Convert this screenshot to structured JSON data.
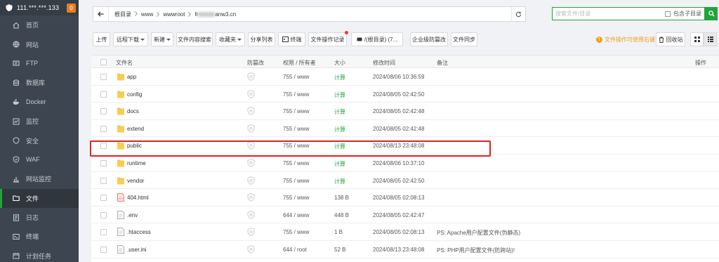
{
  "server": {
    "ip": "111.***.***.133",
    "badge": "0"
  },
  "sidebar": {
    "items": [
      {
        "label": "首页",
        "icon": "home-icon"
      },
      {
        "label": "网站",
        "icon": "globe-icon"
      },
      {
        "label": "FTP",
        "icon": "ftp-icon"
      },
      {
        "label": "数据库",
        "icon": "database-icon"
      },
      {
        "label": "Docker",
        "icon": "docker-icon"
      },
      {
        "label": "监控",
        "icon": "monitor-icon"
      },
      {
        "label": "安全",
        "icon": "shield-icon"
      },
      {
        "label": "WAF",
        "icon": "waf-icon"
      },
      {
        "label": "网站监控",
        "icon": "site-monitor-icon"
      },
      {
        "label": "文件",
        "icon": "folder-icon",
        "active": true
      },
      {
        "label": "日志",
        "icon": "log-icon"
      },
      {
        "label": "终端",
        "icon": "terminal-icon"
      },
      {
        "label": "计划任务",
        "icon": "calendar-icon"
      }
    ]
  },
  "path": {
    "root": "根目录",
    "segments": [
      "www",
      "wwwroot"
    ],
    "domain_prefix": "fr",
    "domain_suffix": "anw3.cn"
  },
  "search": {
    "placeholder": "搜索文件/目录",
    "include_sub": "包含子目录"
  },
  "toolbar": {
    "upload": "上传",
    "remote_download": "远程下载",
    "new": "新建",
    "content_search": "文件内容搜索",
    "favorites": "收藏夹",
    "share_list": "分享列表",
    "terminal": "终端",
    "operation_log": "文件操作记录",
    "disk": "/(根目录) (7...",
    "tamper_proof": "企业级防篡改",
    "file_sync": "文件同步",
    "tip": "文件操作可使用右键",
    "recycle": "回收站"
  },
  "table": {
    "headers": {
      "name": "文件名",
      "protect": "防篡改",
      "perm": "权限 / 所有者",
      "size": "大小",
      "mtime": "修改时间",
      "note": "备注",
      "action": "操作"
    },
    "rows": [
      {
        "name": "app",
        "type": "folder",
        "perm": "755 / www",
        "size": "计算",
        "mtime": "2024/08/06 10:36:59",
        "note": ""
      },
      {
        "name": "config",
        "type": "folder",
        "perm": "755 / www",
        "size": "计算",
        "mtime": "2024/08/05 02:42:50",
        "note": ""
      },
      {
        "name": "docs",
        "type": "folder",
        "perm": "755 / www",
        "size": "计算",
        "mtime": "2024/08/05 02:42:48",
        "note": ""
      },
      {
        "name": "extend",
        "type": "folder",
        "perm": "755 / www",
        "size": "计算",
        "mtime": "2024/08/05 02:42:48",
        "note": ""
      },
      {
        "name": "public",
        "type": "folder",
        "perm": "755 / www",
        "size": "计算",
        "mtime": "2024/08/13 23:48:08",
        "note": ""
      },
      {
        "name": "runtime",
        "type": "folder",
        "perm": "755 / www",
        "size": "计算",
        "mtime": "2024/08/06 10:37:10",
        "note": ""
      },
      {
        "name": "vendor",
        "type": "folder",
        "perm": "755 / www",
        "size": "计算",
        "mtime": "2024/08/05 02:42:50",
        "note": ""
      },
      {
        "name": "404.html",
        "type": "html",
        "perm": "755 / www",
        "size": "138 B",
        "mtime": "2024/08/05 02:08:13",
        "note": ""
      },
      {
        "name": ".env",
        "type": "file",
        "perm": "644 / www",
        "size": "448 B",
        "mtime": "2024/08/05 02:42:47",
        "note": ""
      },
      {
        "name": ".htaccess",
        "type": "file",
        "perm": "755 / www",
        "size": "1 B",
        "mtime": "2024/08/05 02:08:13",
        "note": "PS: Apache用户配置文件(伪静态)"
      },
      {
        "name": ".user.ini",
        "type": "file",
        "perm": "644 / root",
        "size": "52 B",
        "mtime": "2024/08/13 23:48:08",
        "note": "PS: PHP用户配置文件(防跨站)!"
      }
    ]
  },
  "colors": {
    "accent": "#20a53a",
    "sidebar_bg": "#3d4650",
    "highlight": "#e02020",
    "folder": "#f5c342",
    "tip": "#f0a020"
  }
}
